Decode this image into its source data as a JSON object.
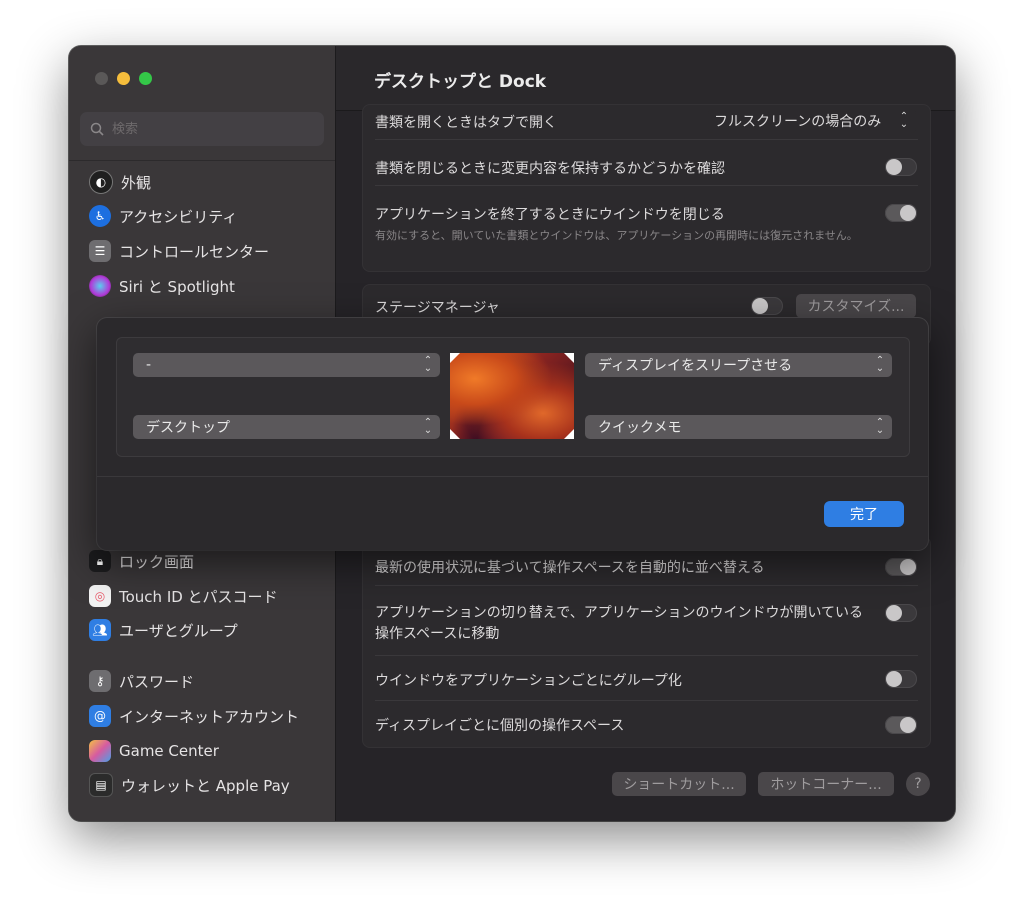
{
  "window": {
    "title": "デスクトップと Dock"
  },
  "colors": {
    "accent": "#2f7ee3",
    "close": "#5a5858",
    "minimize": "#f5bd3c",
    "maximize": "#34c748"
  },
  "sidebar": {
    "search_placeholder": "検索",
    "items": [
      {
        "label": "外観",
        "icon": "appearance-icon",
        "color": "#1f1f1f"
      },
      {
        "label": "アクセシビリティ",
        "icon": "accessibility-icon",
        "color": "#1d6fe0"
      },
      {
        "label": "コントロールセンター",
        "icon": "control-center-icon",
        "color": "#6e6d70"
      },
      {
        "label": "Siri と Spotlight",
        "icon": "siri-icon",
        "color": "#b23ad8"
      },
      {
        "label": "ロック画面",
        "icon": "lock-icon",
        "color": "#1c1c1e"
      },
      {
        "label": "Touch ID とパスコード",
        "icon": "fingerprint-icon",
        "color": "#e85a6a"
      },
      {
        "label": "ユーザとグループ",
        "icon": "users-icon",
        "color": "#2f7ee3"
      },
      {
        "label": "パスワード",
        "icon": "key-icon",
        "color": "#6e6d70"
      },
      {
        "label": "インターネットアカウント",
        "icon": "at-icon",
        "color": "#2f7ee3"
      },
      {
        "label": "Game Center",
        "icon": "game-center-icon",
        "color": "#d65ba0"
      },
      {
        "label": "ウォレットと Apple Pay",
        "icon": "wallet-icon",
        "color": "#2b2b2b"
      }
    ]
  },
  "main": {
    "row_tabs": {
      "label": "書類を開くときはタブで開く",
      "value": "フルスクリーンの場合のみ"
    },
    "row_confirm": {
      "label": "書類を閉じるときに変更内容を保持するかどうかを確認"
    },
    "row_close_windows": {
      "label": "アプリケーションを終了するときにウインドウを閉じる",
      "sub": "有効にすると、開いていた書類とウインドウは、アプリケーションの再開時には復元されません。"
    },
    "stage_manager": {
      "label": "ステージマネージャ",
      "customize": "カスタマイズ..."
    },
    "row_rearrange": {
      "label": "最新の使用状況に基づいて操作スペースを自動的に並べ替える"
    },
    "row_switch": {
      "label": "アプリケーションの切り替えで、アプリケーションのウインドウが開いている操作スペースに移動"
    },
    "row_group": {
      "label": "ウインドウをアプリケーションごとにグループ化"
    },
    "row_separate": {
      "label": "ディスプレイごとに個別の操作スペース"
    },
    "footer": {
      "shortcuts": "ショートカット...",
      "hot_corners": "ホットコーナー...",
      "help": "?"
    }
  },
  "sheet": {
    "top_left": "-",
    "top_right": "ディスプレイをスリープさせる",
    "bottom_left": "デスクトップ",
    "bottom_right": "クイックメモ",
    "done": "完了"
  }
}
